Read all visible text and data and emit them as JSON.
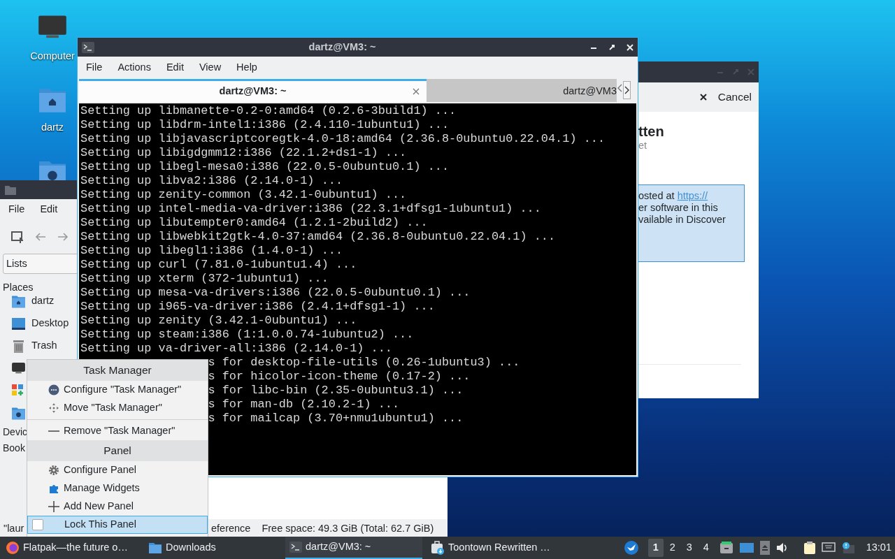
{
  "desktop_icons": [
    {
      "label": "Computer",
      "kind": "computer"
    },
    {
      "label": "dartz",
      "kind": "home"
    },
    {
      "kind": "network"
    }
  ],
  "discover": {
    "cancel": "Cancel",
    "title": "tten",
    "subtitle": "et",
    "info": [
      {
        "text": "osted at ",
        "link": "https://"
      },
      {
        "text": "er software in this"
      },
      {
        "text": "vailable in Discover"
      }
    ]
  },
  "file_manager": {
    "menu": [
      "File",
      "Edit"
    ],
    "side_pane": "Lists",
    "places_heading": "Places",
    "places": [
      {
        "label": "dartz",
        "kind": "home"
      },
      {
        "label": "Desktop",
        "kind": "desktop"
      },
      {
        "label": "Trash",
        "kind": "trash"
      },
      {
        "kind": "computer"
      },
      {
        "kind": "apps"
      },
      {
        "kind": "network"
      }
    ],
    "sections": [
      "Devic",
      "Book"
    ],
    "status": [
      "\"laur",
      "eference",
      "Free space: 49.3 GiB (Total: 62.7 GiB)"
    ]
  },
  "terminal": {
    "title": "dartz@VM3: ~",
    "menu": [
      "File",
      "Actions",
      "Edit",
      "View",
      "Help"
    ],
    "tabs": [
      {
        "label": "dartz@VM3: ~",
        "selected": true
      },
      {
        "label": "dartz@VM3",
        "selected": false
      }
    ],
    "lines": [
      {
        "text": "Setting up libmanette-0.2-0:amd64 (0.2.6-3build1) ...",
        "kind": "full"
      },
      {
        "text": "Setting up libdrm-intel1:i386 (2.4.110-1ubuntu1) ...",
        "kind": "full"
      },
      {
        "text": "Setting up libjavascriptcoregtk-4.0-18:amd64 (2.36.8-0ubuntu0.22.04.1) ...",
        "kind": "full"
      },
      {
        "text": "Setting up libigdgmm12:i386 (22.1.2+ds1-1) ...",
        "kind": "full"
      },
      {
        "text": "Setting up libegl-mesa0:i386 (22.0.5-0ubuntu0.1) ...",
        "kind": "full"
      },
      {
        "text": "Setting up libva2:i386 (2.14.0-1) ...",
        "kind": "full"
      },
      {
        "text": "Setting up zenity-common (3.42.1-0ubuntu1) ...",
        "kind": "full"
      },
      {
        "text": "Setting up intel-media-va-driver:i386 (22.3.1+dfsg1-1ubuntu1) ...",
        "kind": "full"
      },
      {
        "text": "Setting up libutempter0:amd64 (1.2.1-2build2) ...",
        "kind": "full"
      },
      {
        "text": "Setting up libwebkit2gtk-4.0-37:amd64 (2.36.8-0ubuntu0.22.04.1) ...",
        "kind": "full"
      },
      {
        "text": "Setting up libegl1:i386 (1.4.0-1) ...",
        "kind": "full"
      },
      {
        "text": "Setting up curl (7.81.0-1ubuntu1.4) ...",
        "kind": "full"
      },
      {
        "text": "Setting up xterm (372-1ubuntu1) ...",
        "kind": "full"
      },
      {
        "text": "Setting up mesa-va-drivers:i386 (22.0.5-0ubuntu0.1) ...",
        "kind": "full"
      },
      {
        "text": "Setting up i965-va-driver:i386 (2.4.1+dfsg1-1) ...",
        "kind": "full"
      },
      {
        "text": "Setting up zenity (3.42.1-0ubuntu1) ...",
        "kind": "full"
      },
      {
        "text": "Setting up steam:i386 (1:1.0.0.74-1ubuntu2) ...",
        "kind": "full"
      },
      {
        "text": "Setting up va-driver-all:i386 (2.14.0-1) ...",
        "kind": "full"
      },
      {
        "text": "s for desktop-file-utils (0.26-1ubuntu3) ...",
        "kind": "covered"
      },
      {
        "text": "s for hicolor-icon-theme (0.17-2) ...",
        "kind": "covered"
      },
      {
        "text": "s for libc-bin (2.35-0ubuntu3.1) ...",
        "kind": "covered"
      },
      {
        "text": "s for man-db (2.10.2-1) ...",
        "kind": "covered"
      },
      {
        "text": "s for mailcap (3.70+nmu1ubuntu1) ...",
        "kind": "covered"
      }
    ]
  },
  "context_menu": [
    {
      "kind": "header",
      "label": "Task Manager"
    },
    {
      "kind": "item",
      "label": "Configure \"Task Manager\"",
      "selected": false
    },
    {
      "kind": "item",
      "label": "Move \"Task Manager\"",
      "selected": false
    },
    {
      "kind": "separator"
    },
    {
      "kind": "item",
      "label": "Remove \"Task Manager\"",
      "selected": false
    },
    {
      "kind": "header",
      "label": "Panel"
    },
    {
      "kind": "item",
      "label": "Configure Panel",
      "selected": false
    },
    {
      "kind": "item",
      "label": "Manage Widgets",
      "selected": false
    },
    {
      "kind": "item",
      "label": "Add New Panel",
      "selected": false
    },
    {
      "kind": "checkbox",
      "label": "Lock This Panel",
      "checked": false,
      "selected": true
    }
  ],
  "taskbar": {
    "tasks": [
      {
        "label": "Flatpak—the future o…",
        "kind": "browser",
        "selected": false
      },
      {
        "label": "Downloads",
        "kind": "folder",
        "selected": false
      },
      {
        "label": "dartz@VM3: ~",
        "kind": "terminal",
        "selected": true
      },
      {
        "label": "Toontown Rewritten …",
        "kind": "installer",
        "selected": false
      }
    ],
    "workspaces": [
      {
        "label": "1",
        "selected": true
      },
      {
        "label": "2",
        "selected": false
      },
      {
        "label": "3",
        "selected": false
      },
      {
        "label": "4",
        "selected": false
      }
    ],
    "clock": "13:01"
  }
}
